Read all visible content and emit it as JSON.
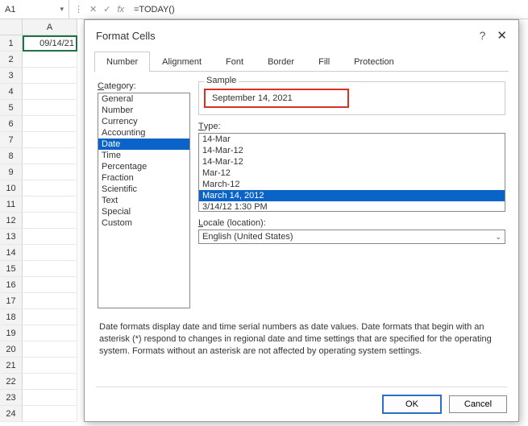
{
  "formula_bar": {
    "name_box": "A1",
    "cancel_icon": "✕",
    "confirm_icon": "✓",
    "fx_label": "fx",
    "formula": "=TODAY()"
  },
  "sheet": {
    "col_headers": [
      "A"
    ],
    "row_numbers": [
      "1",
      "2",
      "3",
      "4",
      "5",
      "6",
      "7",
      "8",
      "9",
      "10",
      "11",
      "12",
      "13",
      "14",
      "15",
      "16",
      "17",
      "18",
      "19",
      "20",
      "21",
      "22",
      "23",
      "24"
    ],
    "a1_value": "09/14/21"
  },
  "dialog": {
    "title": "Format Cells",
    "help": "?",
    "close": "✕",
    "tabs": [
      "Number",
      "Alignment",
      "Font",
      "Border",
      "Fill",
      "Protection"
    ],
    "active_tab": "Number",
    "category_label": "Category:",
    "categories": [
      "General",
      "Number",
      "Currency",
      "Accounting",
      "Date",
      "Time",
      "Percentage",
      "Fraction",
      "Scientific",
      "Text",
      "Special",
      "Custom"
    ],
    "selected_category": "Date",
    "sample_label": "Sample",
    "sample_value": "September 14, 2021",
    "type_label": "Type:",
    "types": [
      "14-Mar",
      "14-Mar-12",
      "14-Mar-12",
      "Mar-12",
      "March-12",
      "March 14, 2012",
      "3/14/12 1:30 PM"
    ],
    "selected_type": "March 14, 2012",
    "locale_label": "Locale (location):",
    "locale_value": "English (United States)",
    "description": "Date formats display date and time serial numbers as date values.  Date formats that begin with an asterisk (*) respond to changes in regional date and time settings that are specified for the operating system. Formats without an asterisk are not affected by operating system settings.",
    "ok": "OK",
    "cancel": "Cancel"
  }
}
